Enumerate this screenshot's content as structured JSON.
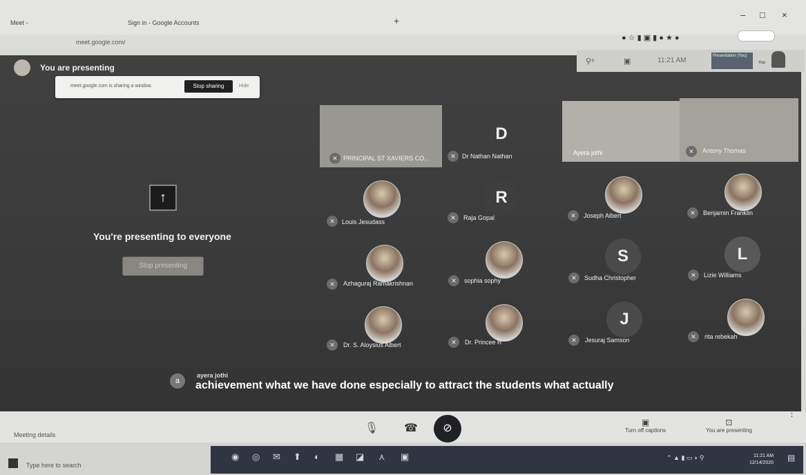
{
  "browser": {
    "tabs": [
      "Meet - ",
      "Sign in - Google Accounts"
    ],
    "new_tab": "+",
    "url": "meet.google.com/",
    "window_controls": [
      "–",
      "□",
      "×"
    ]
  },
  "meet": {
    "banner_title": "You are presenting",
    "share_notice": "meet.google.com is sharing a window.",
    "stop_sharing": "Stop sharing",
    "hide": "Hide",
    "time": "11:21 AM",
    "presentation_thumb_label": "Presentation (You)",
    "self_label": "You",
    "presenting_heading": "You're presenting to everyone",
    "stop_presenting": "Stop presenting",
    "upload_icon": "↑",
    "participants": [
      {
        "name": "PRINCIPAL ST XAVIERS CO...",
        "type": "video"
      },
      {
        "name": "Dr Nathan Nathan",
        "type": "initial",
        "initial": "D"
      },
      {
        "name": "Ayera jothi",
        "type": "video"
      },
      {
        "name": "Antony Thomas",
        "type": "video"
      },
      {
        "name": "Louis Jesudass",
        "type": "photo"
      },
      {
        "name": "Raja Gopal",
        "type": "initial",
        "initial": "R"
      },
      {
        "name": "Joseph Albert",
        "type": "photo"
      },
      {
        "name": "Benjamin Franklin",
        "type": "photo"
      },
      {
        "name": "Azhaguraj Ramakrishnan",
        "type": "photo"
      },
      {
        "name": "sophia sophy",
        "type": "photo"
      },
      {
        "name": "Sudha Christopher",
        "type": "initial",
        "initial": "S"
      },
      {
        "name": "Lizie Williams",
        "type": "initial",
        "initial": "L"
      },
      {
        "name": "Dr. S. Aloysius Albert",
        "type": "photo"
      },
      {
        "name": "Dr. Princee R",
        "type": "photo"
      },
      {
        "name": "Jesuraj Samson",
        "type": "initial",
        "initial": "J"
      },
      {
        "name": "rita rebekah",
        "type": "photo"
      }
    ],
    "caption": {
      "avatar_letter": "a",
      "speaker": "ayera jothi",
      "text": "achievement what we have done especially to attract the students what actually"
    },
    "bottom": {
      "meeting_details": "Meeting details",
      "turn_off_captions": "Turn off captions",
      "you_are_presenting": "You are presenting",
      "more": "⋮"
    }
  },
  "taskbar": {
    "search_placeholder": "Type here to search",
    "time": "11:21 AM",
    "date": "12/14/2020"
  },
  "colors": {
    "stage": "#3a3a3a",
    "end_call": "#202124",
    "stop_sharing_btn": "#202020"
  }
}
